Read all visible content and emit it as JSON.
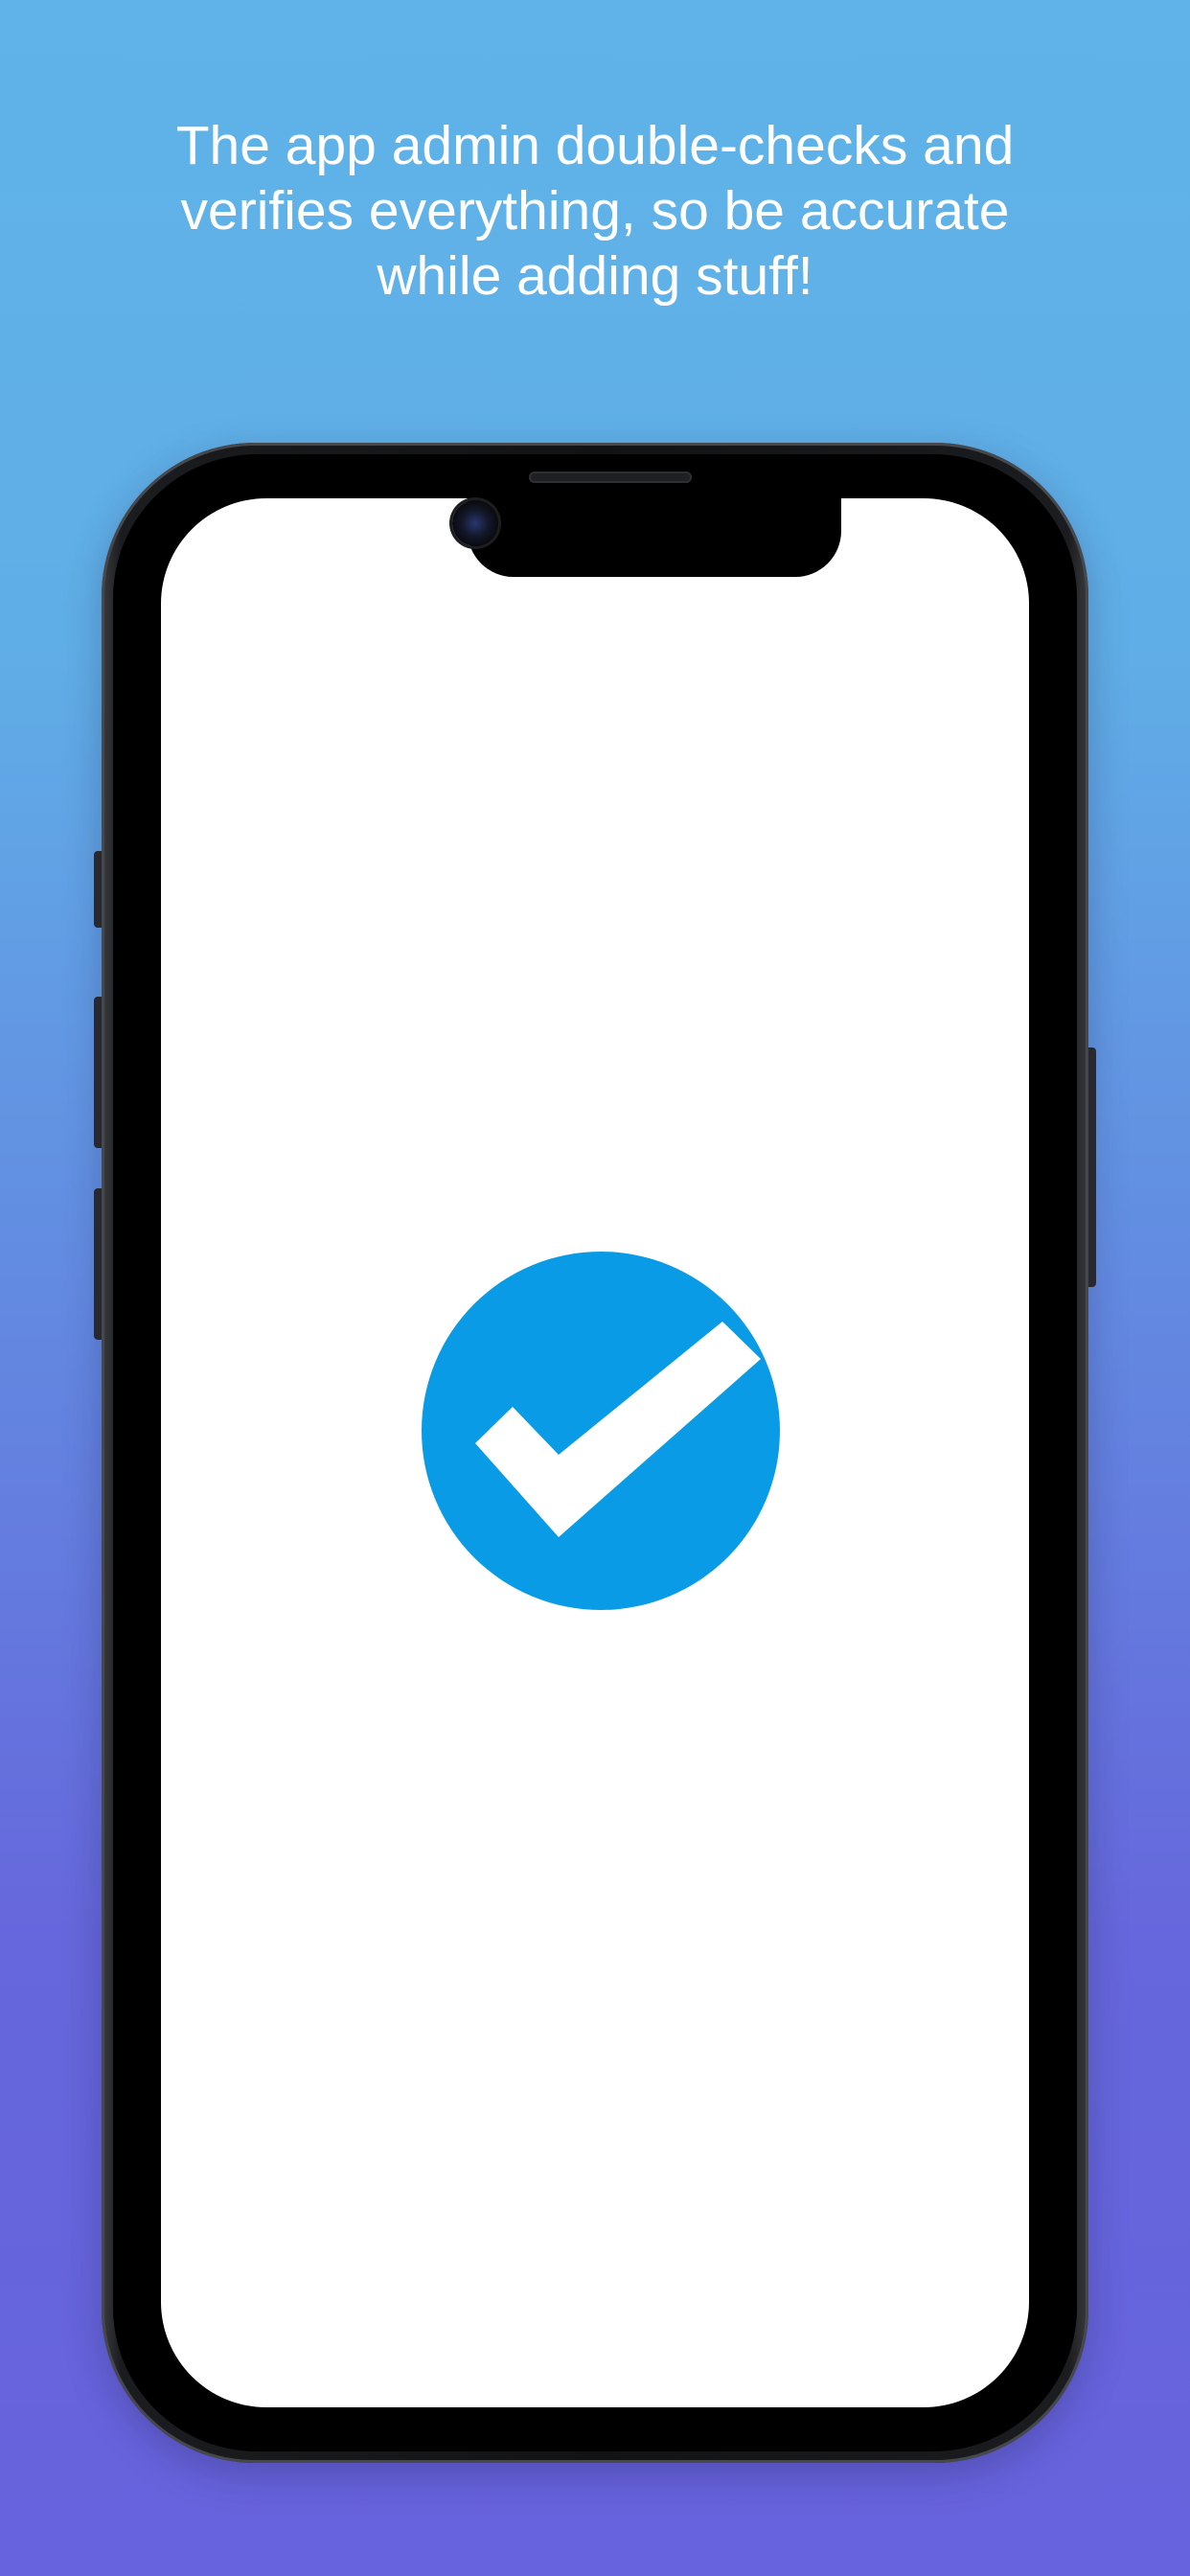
{
  "headline": {
    "text": "The app admin double-checks and\nverifies everything, so be accurate\nwhile adding stuff!"
  },
  "colors": {
    "background_top": "#5fb3e8",
    "background_bottom": "#6762dd",
    "badge": "#0a9be6",
    "checkmark": "#ffffff",
    "screen": "#ffffff",
    "device": "#000000"
  },
  "icons": {
    "center": "verified-checkmark-icon",
    "camera": "front-camera-icon"
  }
}
